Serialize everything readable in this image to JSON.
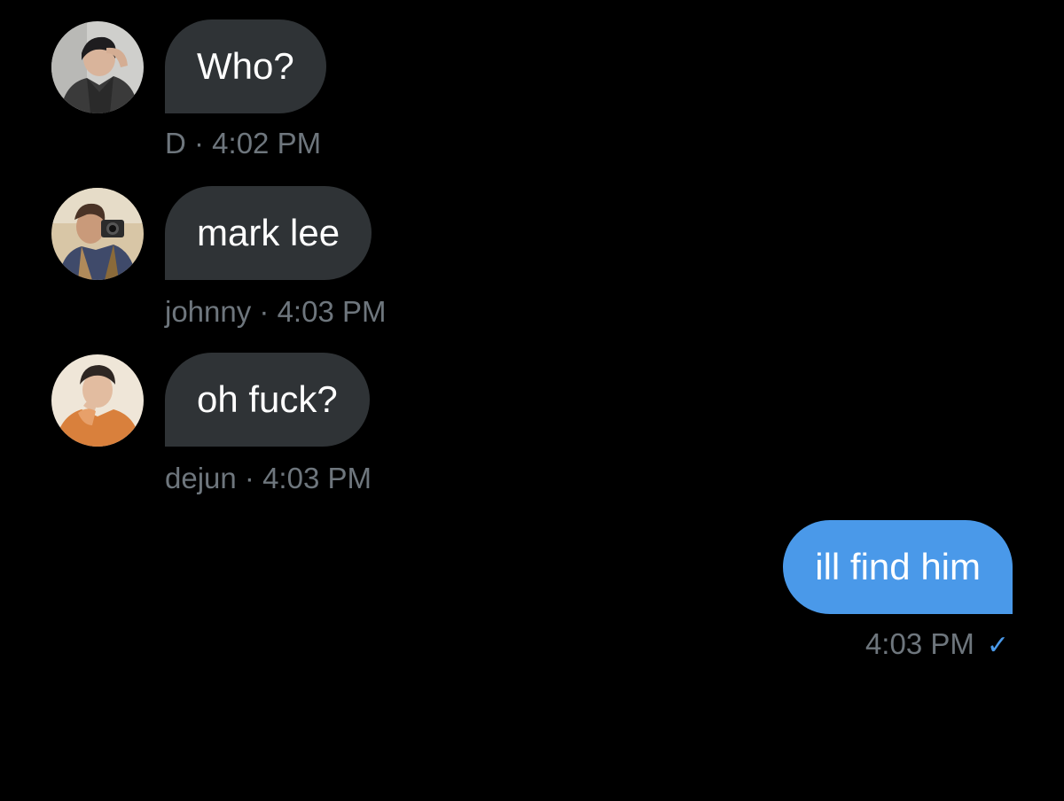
{
  "messages": [
    {
      "sender": "D",
      "text": "Who?",
      "time": "4:02 PM"
    },
    {
      "sender": "johnny",
      "text": "mark lee",
      "time": "4:03 PM"
    },
    {
      "sender": "dejun",
      "text": "oh fuck?",
      "time": "4:03 PM"
    }
  ],
  "outgoing": {
    "text": "ill find him",
    "time": "4:03 PM",
    "status_icon": "checkmark-icon"
  },
  "separator": " · ",
  "colors": {
    "background": "#000000",
    "incoming_bubble": "#2f3336",
    "outgoing_bubble": "#4a99e9",
    "meta_text": "#6e767d",
    "check": "#4a99e9"
  }
}
